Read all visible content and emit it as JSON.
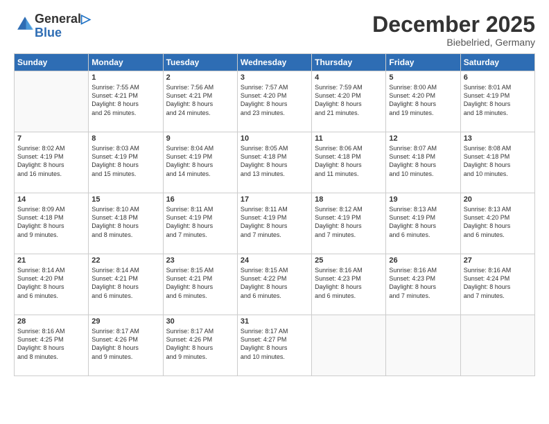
{
  "header": {
    "logo_line1": "General",
    "logo_line2": "Blue",
    "month": "December 2025",
    "location": "Biebelried, Germany"
  },
  "weekdays": [
    "Sunday",
    "Monday",
    "Tuesday",
    "Wednesday",
    "Thursday",
    "Friday",
    "Saturday"
  ],
  "weeks": [
    [
      {
        "num": "",
        "info": ""
      },
      {
        "num": "1",
        "info": "Sunrise: 7:55 AM\nSunset: 4:21 PM\nDaylight: 8 hours\nand 26 minutes."
      },
      {
        "num": "2",
        "info": "Sunrise: 7:56 AM\nSunset: 4:21 PM\nDaylight: 8 hours\nand 24 minutes."
      },
      {
        "num": "3",
        "info": "Sunrise: 7:57 AM\nSunset: 4:20 PM\nDaylight: 8 hours\nand 23 minutes."
      },
      {
        "num": "4",
        "info": "Sunrise: 7:59 AM\nSunset: 4:20 PM\nDaylight: 8 hours\nand 21 minutes."
      },
      {
        "num": "5",
        "info": "Sunrise: 8:00 AM\nSunset: 4:20 PM\nDaylight: 8 hours\nand 19 minutes."
      },
      {
        "num": "6",
        "info": "Sunrise: 8:01 AM\nSunset: 4:19 PM\nDaylight: 8 hours\nand 18 minutes."
      }
    ],
    [
      {
        "num": "7",
        "info": "Sunrise: 8:02 AM\nSunset: 4:19 PM\nDaylight: 8 hours\nand 16 minutes."
      },
      {
        "num": "8",
        "info": "Sunrise: 8:03 AM\nSunset: 4:19 PM\nDaylight: 8 hours\nand 15 minutes."
      },
      {
        "num": "9",
        "info": "Sunrise: 8:04 AM\nSunset: 4:19 PM\nDaylight: 8 hours\nand 14 minutes."
      },
      {
        "num": "10",
        "info": "Sunrise: 8:05 AM\nSunset: 4:18 PM\nDaylight: 8 hours\nand 13 minutes."
      },
      {
        "num": "11",
        "info": "Sunrise: 8:06 AM\nSunset: 4:18 PM\nDaylight: 8 hours\nand 11 minutes."
      },
      {
        "num": "12",
        "info": "Sunrise: 8:07 AM\nSunset: 4:18 PM\nDaylight: 8 hours\nand 10 minutes."
      },
      {
        "num": "13",
        "info": "Sunrise: 8:08 AM\nSunset: 4:18 PM\nDaylight: 8 hours\nand 10 minutes."
      }
    ],
    [
      {
        "num": "14",
        "info": "Sunrise: 8:09 AM\nSunset: 4:18 PM\nDaylight: 8 hours\nand 9 minutes."
      },
      {
        "num": "15",
        "info": "Sunrise: 8:10 AM\nSunset: 4:18 PM\nDaylight: 8 hours\nand 8 minutes."
      },
      {
        "num": "16",
        "info": "Sunrise: 8:11 AM\nSunset: 4:19 PM\nDaylight: 8 hours\nand 7 minutes."
      },
      {
        "num": "17",
        "info": "Sunrise: 8:11 AM\nSunset: 4:19 PM\nDaylight: 8 hours\nand 7 minutes."
      },
      {
        "num": "18",
        "info": "Sunrise: 8:12 AM\nSunset: 4:19 PM\nDaylight: 8 hours\nand 7 minutes."
      },
      {
        "num": "19",
        "info": "Sunrise: 8:13 AM\nSunset: 4:19 PM\nDaylight: 8 hours\nand 6 minutes."
      },
      {
        "num": "20",
        "info": "Sunrise: 8:13 AM\nSunset: 4:20 PM\nDaylight: 8 hours\nand 6 minutes."
      }
    ],
    [
      {
        "num": "21",
        "info": "Sunrise: 8:14 AM\nSunset: 4:20 PM\nDaylight: 8 hours\nand 6 minutes."
      },
      {
        "num": "22",
        "info": "Sunrise: 8:14 AM\nSunset: 4:21 PM\nDaylight: 8 hours\nand 6 minutes."
      },
      {
        "num": "23",
        "info": "Sunrise: 8:15 AM\nSunset: 4:21 PM\nDaylight: 8 hours\nand 6 minutes."
      },
      {
        "num": "24",
        "info": "Sunrise: 8:15 AM\nSunset: 4:22 PM\nDaylight: 8 hours\nand 6 minutes."
      },
      {
        "num": "25",
        "info": "Sunrise: 8:16 AM\nSunset: 4:23 PM\nDaylight: 8 hours\nand 6 minutes."
      },
      {
        "num": "26",
        "info": "Sunrise: 8:16 AM\nSunset: 4:23 PM\nDaylight: 8 hours\nand 7 minutes."
      },
      {
        "num": "27",
        "info": "Sunrise: 8:16 AM\nSunset: 4:24 PM\nDaylight: 8 hours\nand 7 minutes."
      }
    ],
    [
      {
        "num": "28",
        "info": "Sunrise: 8:16 AM\nSunset: 4:25 PM\nDaylight: 8 hours\nand 8 minutes."
      },
      {
        "num": "29",
        "info": "Sunrise: 8:17 AM\nSunset: 4:26 PM\nDaylight: 8 hours\nand 9 minutes."
      },
      {
        "num": "30",
        "info": "Sunrise: 8:17 AM\nSunset: 4:26 PM\nDaylight: 8 hours\nand 9 minutes."
      },
      {
        "num": "31",
        "info": "Sunrise: 8:17 AM\nSunset: 4:27 PM\nDaylight: 8 hours\nand 10 minutes."
      },
      {
        "num": "",
        "info": ""
      },
      {
        "num": "",
        "info": ""
      },
      {
        "num": "",
        "info": ""
      }
    ]
  ]
}
